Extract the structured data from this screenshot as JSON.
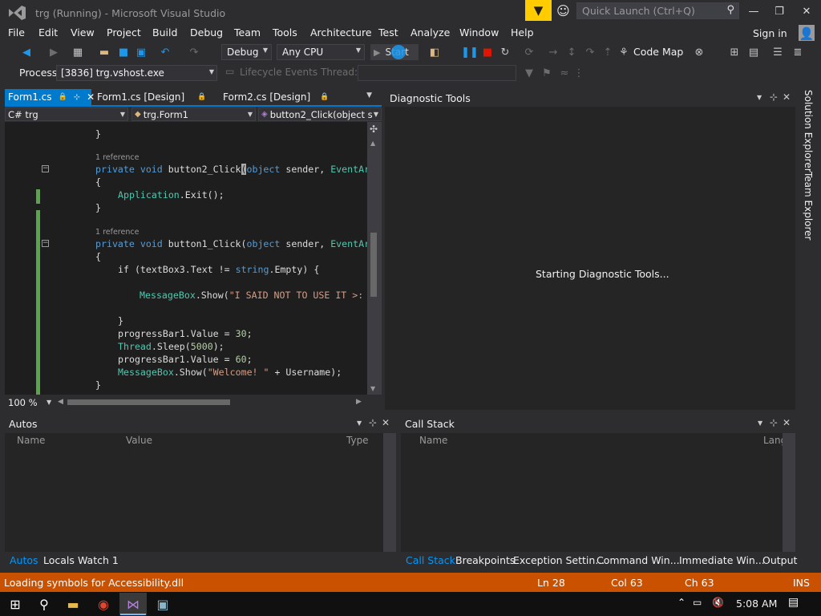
{
  "title_bar": {
    "title": "trg (Running) - Microsoft Visual Studio",
    "quick_launch_placeholder": "Quick Launch (Ctrl+Q)"
  },
  "menu": {
    "items": [
      "File",
      "Edit",
      "View",
      "Project",
      "Build",
      "Debug",
      "Team",
      "Tools",
      "Architecture",
      "Test",
      "Analyze",
      "Window",
      "Help"
    ],
    "sign_in": "Sign in"
  },
  "toolbar": {
    "configuration": "Debug",
    "platform": "Any CPU",
    "start_label": "Start",
    "code_map": "Code Map"
  },
  "debug_location": {
    "process_label": "Process:",
    "process_value": "[3836] trg.vshost.exe",
    "lifecycle_label": "Lifecycle Events",
    "thread_label": "Thread:"
  },
  "editor": {
    "tabs": [
      "Form1.cs",
      "Form1.cs [Design]",
      "Form2.cs [Design]"
    ],
    "nav_project": "C# trg",
    "nav_class": "trg.Form1",
    "nav_member": "button2_Click(object s",
    "references": [
      "1 reference",
      "1 reference"
    ],
    "zoom": "100 %",
    "code": {
      "l1": "}",
      "l3_kw": "private void ",
      "l3_name": "button2_Click",
      "l3_rest_kw": "object",
      "l3_tail": " sender, ",
      "l3_type": "EventAr",
      "l4": "{",
      "l5_type": "Application",
      "l5_rest": ".Exit();",
      "l6": "}",
      "l8_kw": "private void ",
      "l8_name": "button1_Click(",
      "l8_rest_kw": "object",
      "l8_tail": " sender, ",
      "l8_type": "EventAr",
      "l9": "{",
      "l10_a": "if (textBox3.Text != ",
      "l10_kw": "string",
      "l10_b": ".Empty) {",
      "l12_type": "MessageBox",
      "l12_a": ".Show(",
      "l12_str": "\"I SAID NOT TO USE IT >:",
      "l14": "}",
      "l15_a": "progressBar1.Value = ",
      "l15_num": "30",
      "l15_b": ";",
      "l16_type": "Thread",
      "l16_a": ".Sleep(",
      "l16_num": "5000",
      "l16_b": ");",
      "l17_a": "progressBar1.Value = ",
      "l17_num": "60",
      "l17_b": ";",
      "l18_type": "MessageBox",
      "l18_a": ".Show(",
      "l18_str": "\"Welcome! \"",
      "l18_b": " + Username);",
      "l19": "}"
    }
  },
  "diagnostic": {
    "title": "Diagnostic Tools",
    "status": "Starting Diagnostic Tools..."
  },
  "side_tabs": [
    "Solution Explorer",
    "Team Explorer"
  ],
  "autos": {
    "title": "Autos",
    "columns": [
      "Name",
      "Value",
      "Type"
    ],
    "tabs": [
      "Autos",
      "Locals",
      "Watch 1"
    ]
  },
  "call_stack": {
    "title": "Call Stack",
    "columns": [
      "Name",
      "Lang"
    ],
    "tabs": [
      "Call Stack",
      "Breakpoints",
      "Exception Settin...",
      "Command Win...",
      "Immediate Win...",
      "Output"
    ]
  },
  "status": {
    "message": "Loading symbols for Accessibility.dll",
    "line": "Ln 28",
    "col": "Col 63",
    "ch": "Ch 63",
    "mode": "INS"
  },
  "taskbar": {
    "time": "5:08 AM"
  },
  "colors": {
    "accent": "#007acc",
    "status_bar": "#ca5100",
    "quick_filter": "#ffcc00"
  }
}
